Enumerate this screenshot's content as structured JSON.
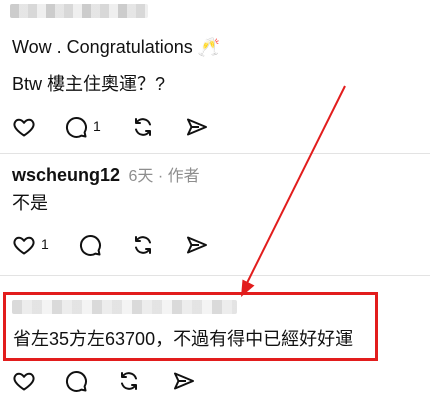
{
  "comment1": {
    "line1": "Wow . Congratulations",
    "emoji": "🥂",
    "line2": "Btw 樓主住奧運？?",
    "reply_count": "1"
  },
  "comment2": {
    "username": "wscheung12",
    "time": "6天",
    "separator": "·",
    "author_tag": "作者",
    "text": "不是",
    "like_count": "1"
  },
  "comment3": {
    "text": "省左35方左63700，不過有得中已經好好運"
  },
  "annotation": {
    "color": "#e21d1d"
  },
  "icons": [
    "heart-icon",
    "comment-icon",
    "repost-icon",
    "share-icon"
  ]
}
